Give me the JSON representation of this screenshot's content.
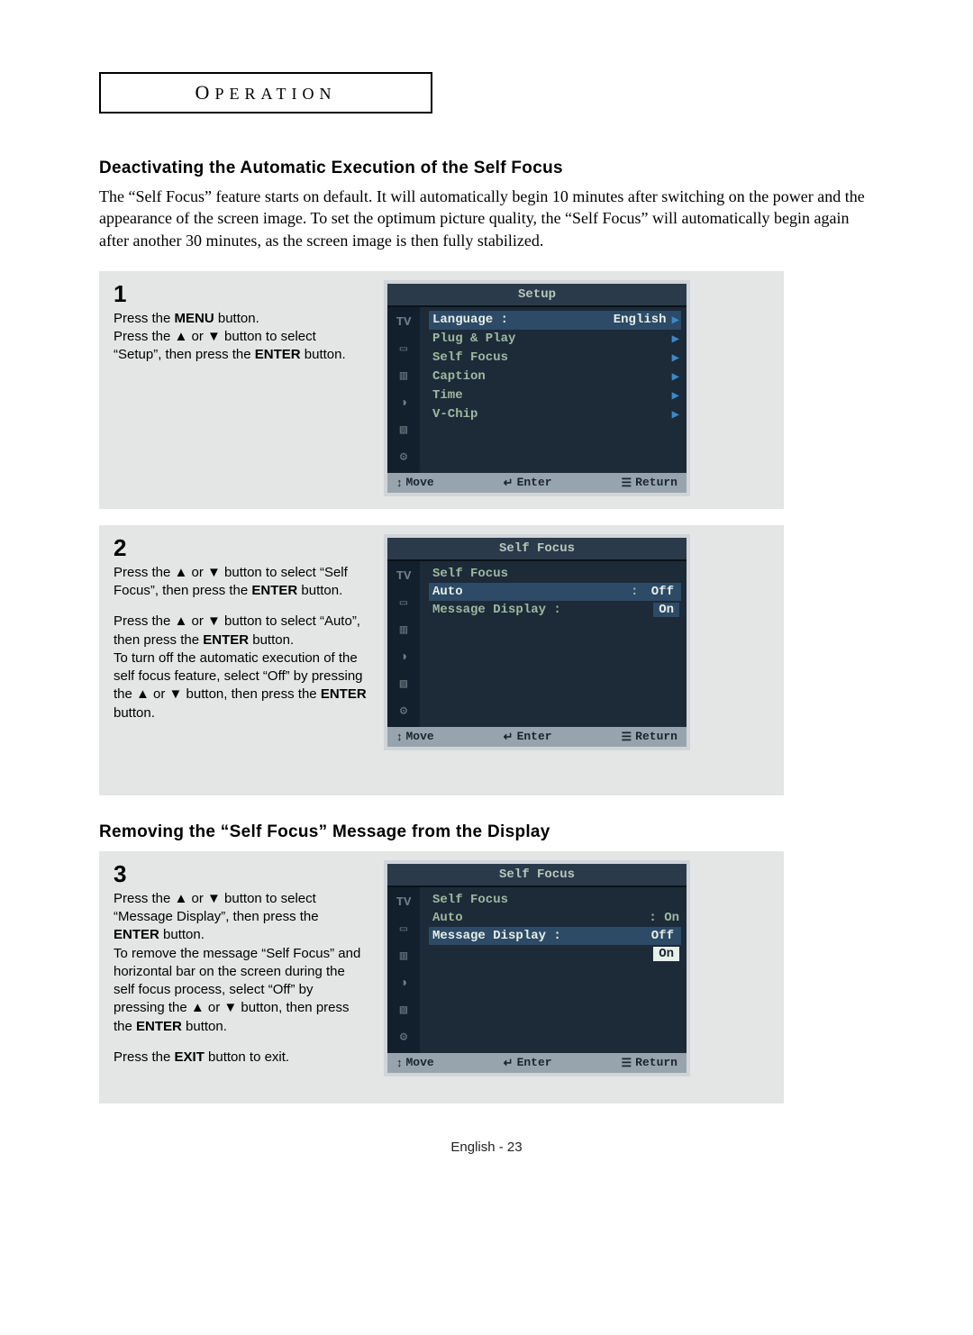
{
  "header_label": "OPERATION",
  "section1": {
    "heading": "Deactivating the Automatic Execution of the Self Focus",
    "intro": "The “Self Focus” feature starts on default. It will automatically begin 10 minutes after switching on the power and the appearance of the screen image. To set the optimum picture quality, the “Self Focus” will automatically begin again after another 30 minutes, as the screen image is then fully stabilized."
  },
  "step1": {
    "num": "1",
    "line1a": "Press the ",
    "line1b": "MENU",
    "line1c": " button.",
    "line2a": "Press the ▲ or ▼ button to select “Setup”, then press the ",
    "line2b": "ENTER",
    "line2c": " button."
  },
  "osd1": {
    "title": "Setup",
    "tv": "TV",
    "rows": [
      {
        "label": "Language  :",
        "value": "English",
        "tri": "▶",
        "sel": true
      },
      {
        "label": "Plug & Play",
        "tri": "▶"
      },
      {
        "label": "Self Focus",
        "tri": "▶"
      },
      {
        "label": "Caption",
        "tri": "▶"
      },
      {
        "label": "Time",
        "tri": "▶"
      },
      {
        "label": "V-Chip",
        "tri": "▶"
      }
    ],
    "footer": {
      "move": "Move",
      "enter": "Enter",
      "return": "Return"
    }
  },
  "step2": {
    "num": "2",
    "p1a": "Press the ▲ or ▼ button to select “Self Focus”, then press the ",
    "p1b": "ENTER",
    "p1c": " button.",
    "p2a": "Press the ▲ or ▼ button to select “Auto”, then press the ",
    "p2b": "ENTER",
    "p2c": " button.",
    "p3a": "To turn off the automatic execution of the self focus feature, select “Off” by pressing the ▲ or ▼ button, then press the ",
    "p3b": "ENTER",
    "p3c": " button."
  },
  "osd2": {
    "title": "Self Focus",
    "tv": "TV",
    "row_sf": "Self Focus",
    "row_auto": "Auto",
    "row_auto_val": "Off",
    "row_msg": "Message Display :",
    "row_msg_val": "On",
    "footer": {
      "move": "Move",
      "enter": "Enter",
      "return": "Return"
    }
  },
  "section2": {
    "heading": "Removing the “Self Focus” Message from the Display"
  },
  "step3": {
    "num": "3",
    "p1a": "Press the ▲ or ▼ button to select “Message Display”, then press the ",
    "p1b": "ENTER",
    "p1c": " button.",
    "p2a": "To remove the message “Self Focus” and horizontal bar on the screen during the self focus process, select “Off” by pressing the ▲ or ▼ button, then press the ",
    "p2b": "ENTER",
    "p2c": " button.",
    "p3a": "Press the ",
    "p3b": "EXIT",
    "p3c": " button to exit."
  },
  "osd3": {
    "title": "Self Focus",
    "tv": "TV",
    "row_sf": "Self Focus",
    "row_auto": "Auto",
    "row_auto_val": "On",
    "row_msg": "Message Display :",
    "row_msg_val": "Off",
    "row_on": "On",
    "footer": {
      "move": "Move",
      "enter": "Enter",
      "return": "Return"
    }
  },
  "page_num": "English - 23",
  "glyphs": {
    "updown": "↕",
    "enter": "↵",
    "menu": "☰"
  }
}
